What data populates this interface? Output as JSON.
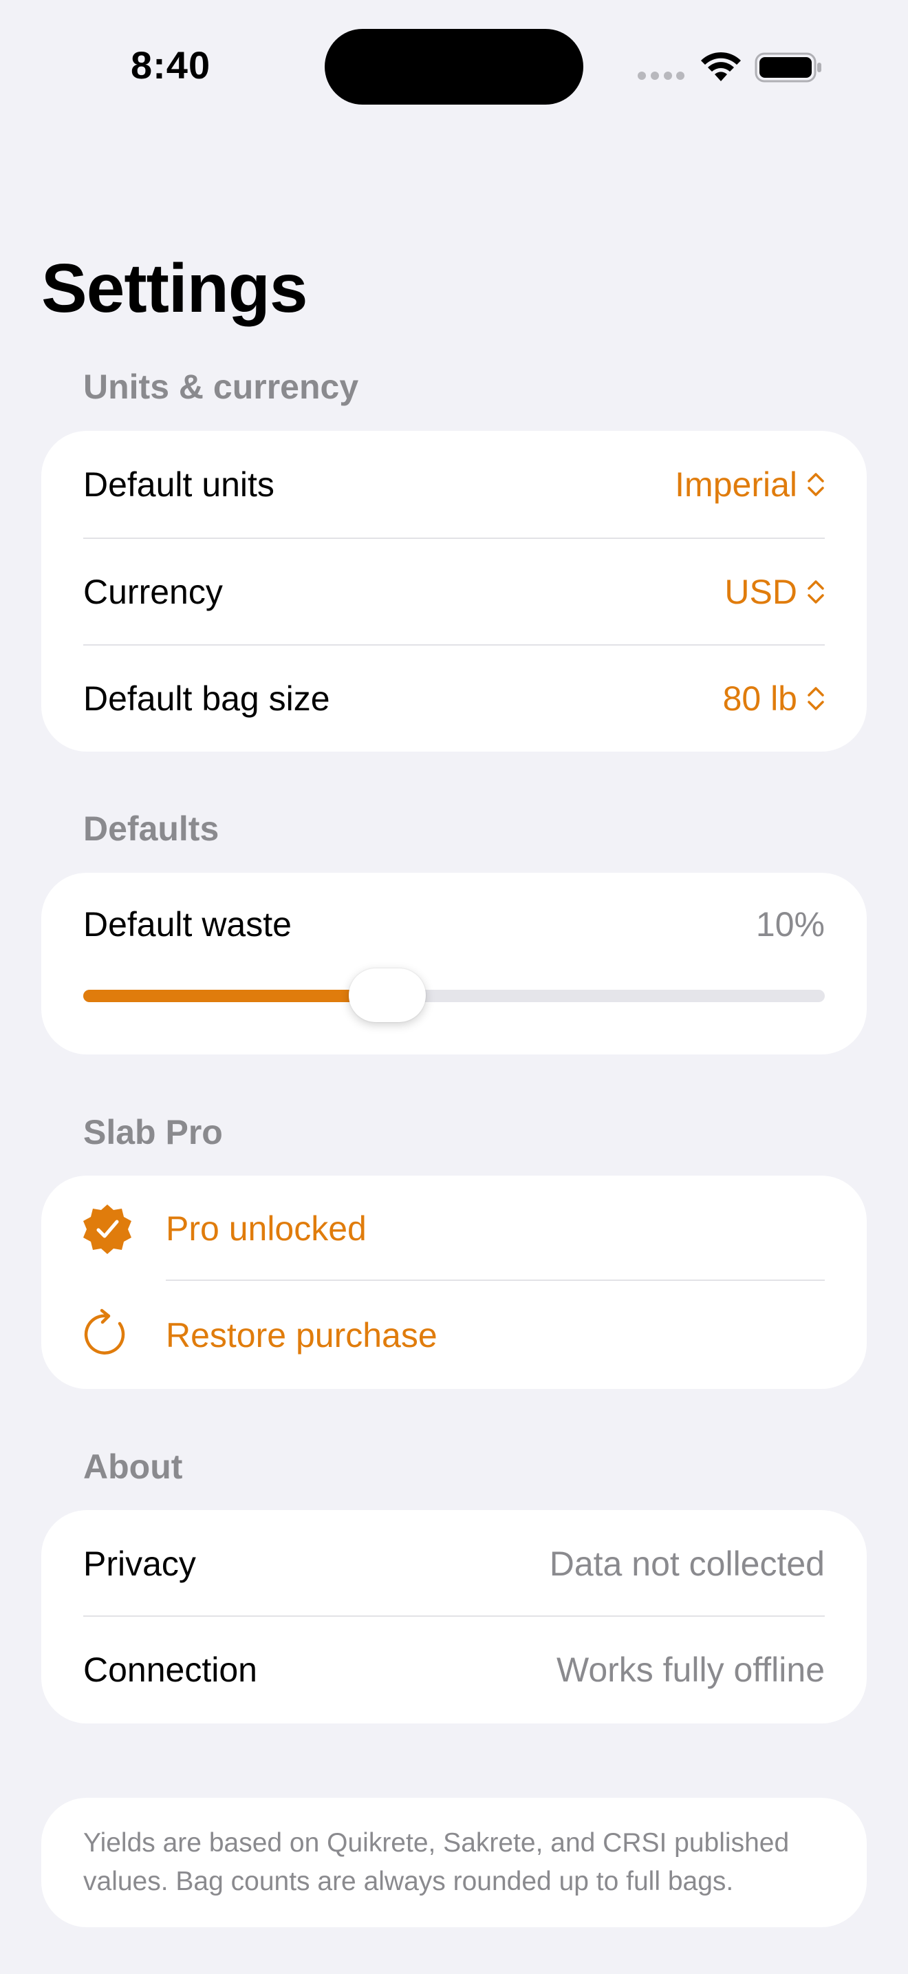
{
  "status_bar": {
    "time": "8:40"
  },
  "title": "Settings",
  "sections": {
    "units": {
      "header": "Units & currency",
      "rows": [
        {
          "label": "Default units",
          "value": "Imperial"
        },
        {
          "label": "Currency",
          "value": "USD"
        },
        {
          "label": "Default bag size",
          "value": "80 lb"
        }
      ]
    },
    "defaults": {
      "header": "Defaults",
      "waste_label": "Default waste",
      "waste_value": "10%",
      "slider_fraction": 0.41
    },
    "pro": {
      "header": "Slab Pro",
      "unlocked_label": "Pro unlocked",
      "restore_label": "Restore purchase"
    },
    "about": {
      "header": "About",
      "rows": [
        {
          "label": "Privacy",
          "value": "Data not collected"
        },
        {
          "label": "Connection",
          "value": "Works fully offline"
        }
      ]
    }
  },
  "footnote": "Yields are based on Quikrete, Sakrete, and CRSI published values. Bag counts are always rounded up to full bags.",
  "colors": {
    "accent": "#e07c0c",
    "background": "#f2f2f7",
    "secondary_text": "#8a8a8e"
  },
  "icons": {
    "pro": "checkmark-seal-icon",
    "restore": "arrow-clockwise-icon",
    "picker": "chevron-up-down-icon"
  }
}
